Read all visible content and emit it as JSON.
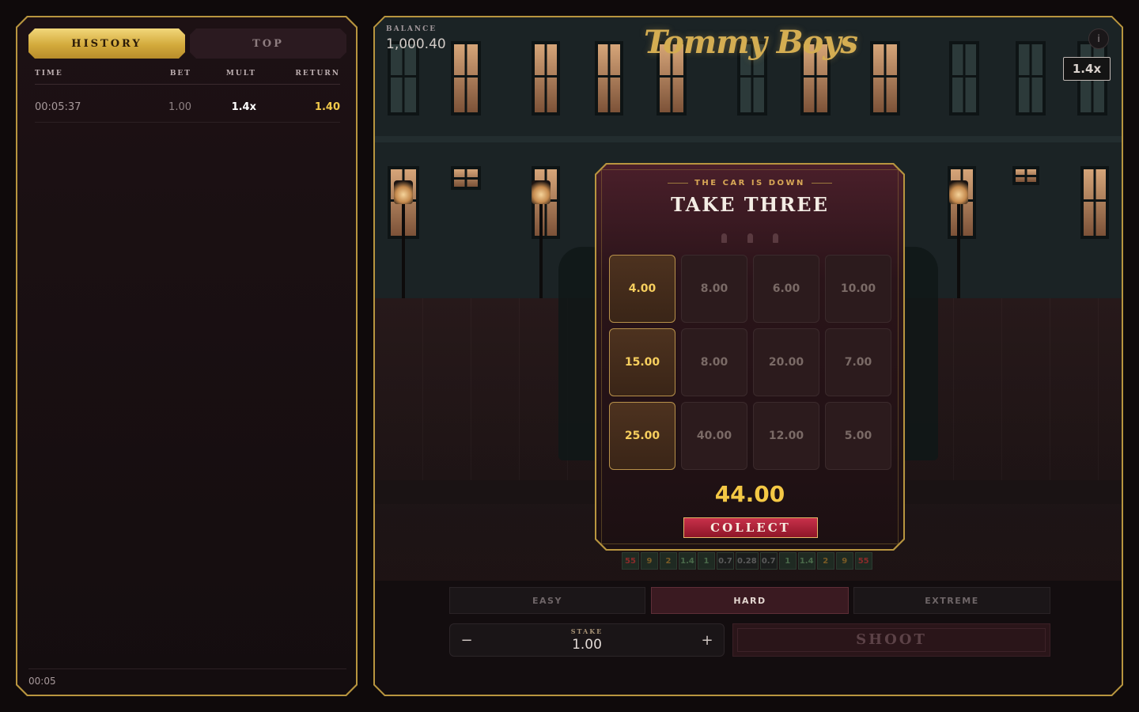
{
  "history_panel": {
    "tabs": [
      {
        "label": "HISTORY",
        "active": true
      },
      {
        "label": "TOP",
        "active": false
      }
    ],
    "columns": {
      "time": "TIME",
      "bet": "BET",
      "mult": "MULT",
      "return": "RETURN"
    },
    "rows": [
      {
        "time": "00:05:37",
        "bet": "1.00",
        "mult": "1.4x",
        "return": "1.40"
      }
    ],
    "footer_time": "00:05"
  },
  "game": {
    "balance_label": "BALANCE",
    "balance_value": "1,000.40",
    "logo_text": "Tommy Boys",
    "info_label": "i",
    "current_multiplier": "1.4x",
    "modal": {
      "subtitle": "THE CAR IS DOWN",
      "title": "TAKE THREE",
      "bullets_remaining": 3,
      "cells": [
        {
          "value": "4.00",
          "picked": true
        },
        {
          "value": "8.00",
          "picked": false
        },
        {
          "value": "6.00",
          "picked": false
        },
        {
          "value": "10.00",
          "picked": false
        },
        {
          "value": "15.00",
          "picked": true
        },
        {
          "value": "8.00",
          "picked": false
        },
        {
          "value": "20.00",
          "picked": false
        },
        {
          "value": "7.00",
          "picked": false
        },
        {
          "value": "25.00",
          "picked": true
        },
        {
          "value": "40.00",
          "picked": false
        },
        {
          "value": "12.00",
          "picked": false
        },
        {
          "value": "5.00",
          "picked": false
        }
      ],
      "total": "44.00",
      "collect_label": "COLLECT"
    },
    "multiplier_strip": [
      {
        "v": "55",
        "tone": "red"
      },
      {
        "v": "9",
        "tone": "orange"
      },
      {
        "v": "2",
        "tone": "orange"
      },
      {
        "v": "1.4",
        "tone": "green"
      },
      {
        "v": "1",
        "tone": "green"
      },
      {
        "v": "0.7",
        "tone": "grey"
      },
      {
        "v": "0.28",
        "tone": "grey"
      },
      {
        "v": "0.7",
        "tone": "grey"
      },
      {
        "v": "1",
        "tone": "green"
      },
      {
        "v": "1.4",
        "tone": "green"
      },
      {
        "v": "2",
        "tone": "orange"
      },
      {
        "v": "9",
        "tone": "orange"
      },
      {
        "v": "55",
        "tone": "red"
      }
    ],
    "difficulty": [
      {
        "label": "EASY",
        "active": false
      },
      {
        "label": "HARD",
        "active": true
      },
      {
        "label": "EXTREME",
        "active": false
      }
    ],
    "stake": {
      "label": "STAKE",
      "value": "1.00",
      "minus": "−",
      "plus": "+"
    },
    "shoot_label": "SHOOT"
  },
  "colors": {
    "gold": "#b8953f",
    "accent_yellow": "#f4c845",
    "collect_red": "#b0233d"
  }
}
